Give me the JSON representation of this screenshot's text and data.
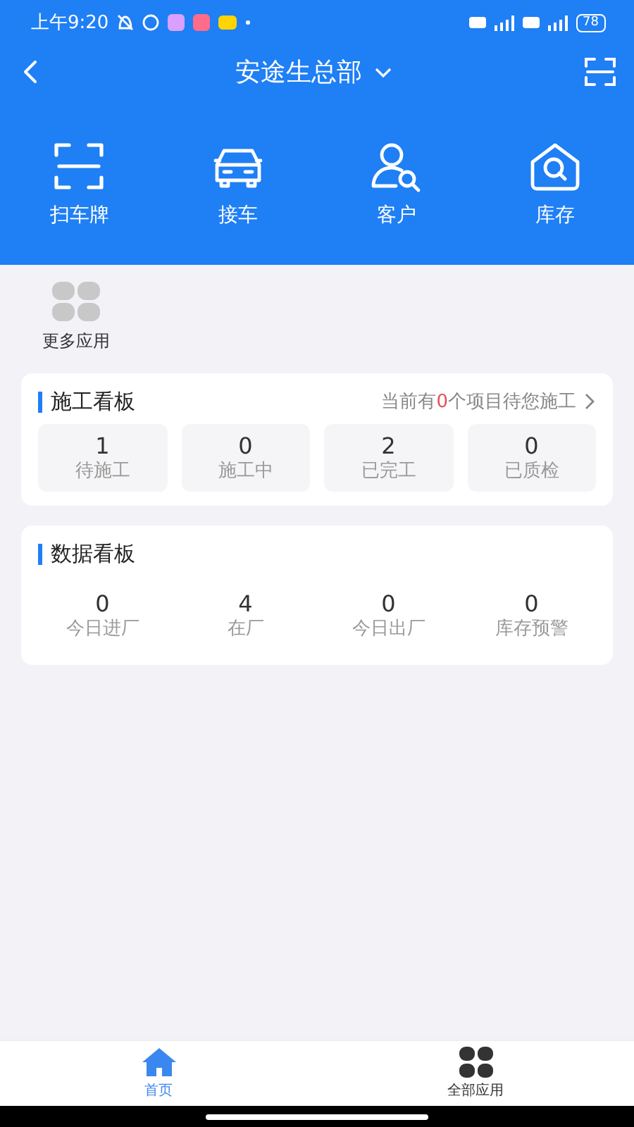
{
  "status_bar": {
    "time": "上午9:20",
    "battery": "78"
  },
  "header": {
    "title": "安途生总部"
  },
  "quick_actions": [
    {
      "kind": "scan",
      "label": "扫车牌"
    },
    {
      "kind": "car",
      "label": "接车"
    },
    {
      "kind": "user-search",
      "label": "客户"
    },
    {
      "kind": "store",
      "label": "库存"
    }
  ],
  "more_apps": {
    "label": "更多应用"
  },
  "construction_board": {
    "title": "施工看板",
    "notice": {
      "before": "当前有",
      "count": "0",
      "after": "个项目待您施工"
    },
    "stats": [
      {
        "value": "1",
        "label": "待施工"
      },
      {
        "value": "0",
        "label": "施工中"
      },
      {
        "value": "2",
        "label": "已完工"
      },
      {
        "value": "0",
        "label": "已质检"
      }
    ]
  },
  "data_board": {
    "title": "数据看板",
    "stats": [
      {
        "value": "0",
        "label": "今日进厂"
      },
      {
        "value": "4",
        "label": "在厂"
      },
      {
        "value": "0",
        "label": "今日出厂"
      },
      {
        "value": "0",
        "label": "库存预警"
      }
    ]
  },
  "tab_bar": [
    {
      "kind": "home",
      "label": "首页",
      "selected": true
    },
    {
      "kind": "grid",
      "label": "全部应用",
      "selected": false
    }
  ]
}
